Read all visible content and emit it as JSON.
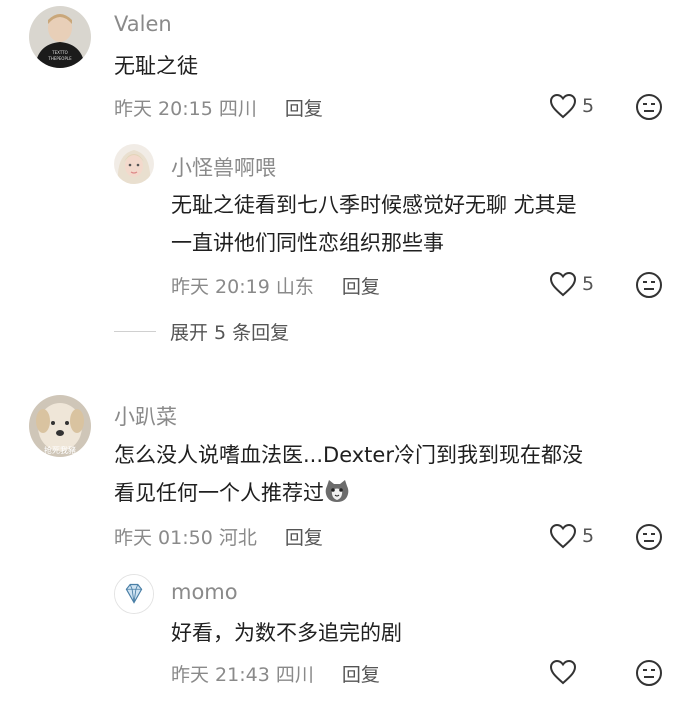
{
  "comments": [
    {
      "name": "Valen",
      "text_lines": [
        "无耻之徒"
      ],
      "time": "昨天 20:15",
      "location": "四川",
      "reply_label": "回复",
      "likes": "5",
      "avatar_text": [
        "TEXTTO",
        "THEPEOPLE"
      ]
    },
    {
      "name": "小怪兽啊喂",
      "text_lines": [
        "无耻之徒看到七八季时候感觉好无聊 尤其是",
        "一直讲他们同性恋组织那些事"
      ],
      "time": "昨天 20:19",
      "location": "山东",
      "reply_label": "回复",
      "likes": "5"
    },
    {
      "name": "小趴菜",
      "text_lines": [
        "怎么没人说嗜血法医...Dexter冷门到我到现在都没",
        "看见任何一个人推荐过"
      ],
      "time": "昨天 01:50",
      "location": "河北",
      "reply_label": "回复",
      "likes": "5",
      "avatar_text": "抢死我豬"
    },
    {
      "name": "momo",
      "text_lines": [
        "好看，为数不多追完的剧"
      ],
      "time": "昨天 21:43",
      "location": "四川",
      "reply_label": "回复",
      "likes": ""
    }
  ],
  "expand_replies": "展开 5 条回复",
  "icons": {
    "like": "heart-outline-icon",
    "dislike": "unamused-face-icon",
    "inline_emoji": "cat-face-emoji-icon"
  }
}
